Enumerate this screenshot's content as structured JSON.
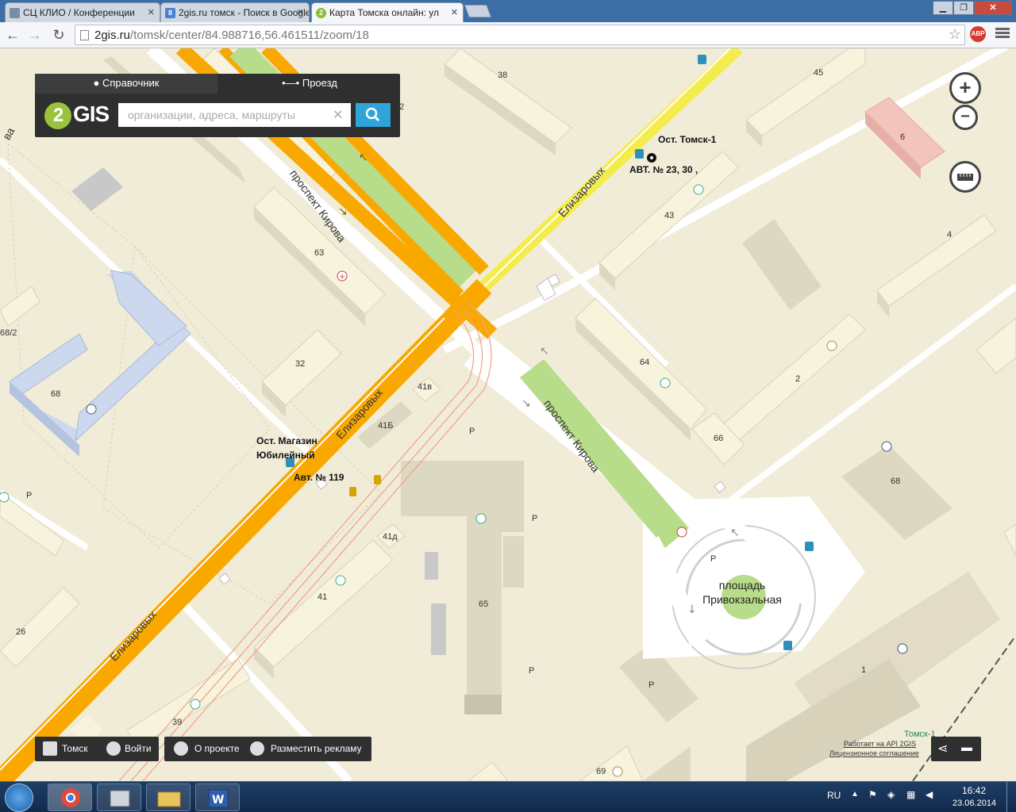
{
  "browser": {
    "tabs": [
      {
        "title": "СЦ КЛИО / Конференции",
        "close": "✕"
      },
      {
        "title": "2gis.ru томск - Поиск в Google",
        "close": "✕"
      },
      {
        "title": "Карта Томска онлайн: ул",
        "close": "✕"
      }
    ],
    "url_host": "2gis.ru",
    "url_path": "/tomsk/center/84.988716,56.461511/zoom/18",
    "abp_label": "ABP"
  },
  "panel": {
    "tab_directory": "Справочник",
    "tab_route": "Проезд",
    "logo_text": "GIS",
    "logo_digit": "2",
    "search_placeholder": "организации, адреса, маршруты",
    "clear": "✕"
  },
  "map": {
    "streets": {
      "kirova_top": "проспект Кирова",
      "kirova_bottom": "проспект Кирова",
      "elizarovykh_top": "Елизаровых",
      "elizarovykh_mid": "Елизаровых",
      "elizarovykh_bottom": "Елизаровых",
      "left_partial": "ва"
    },
    "buildings": [
      "38",
      "45",
      "6",
      "43",
      "4",
      "63",
      "64",
      "2",
      "32",
      "68/2",
      "68",
      "41в",
      "41Б",
      "66",
      "68",
      "41д",
      "41",
      "65",
      "26",
      "39",
      "1",
      "69",
      "2"
    ],
    "stops": {
      "tomsk1_name": "Ост. Томск-1",
      "tomsk1_routes": "АВТ. № 23, 30 ,",
      "magazin_name_1": "Ост. Магазин",
      "magazin_name_2": "Юбилейный",
      "magazin_routes": "Авт. № 119"
    },
    "square_1": "площадь",
    "square_2": "Привокзальная",
    "tomsk1_station": "Томск-1",
    "parking": "P"
  },
  "zoom": {
    "in": "+",
    "out": "−"
  },
  "bottom": {
    "city": "Томск",
    "login": "Войти",
    "about": "О проекте",
    "advertise": "Разместить рекламу",
    "credit_1": "Работает на API 2GIS",
    "credit_2": "Лицензионное соглашение"
  },
  "taskbar": {
    "lang": "RU",
    "time": "16:42",
    "date": "23.06.2014"
  },
  "colors": {
    "main_road": "#f9a800",
    "yellow_road": "#f4ec4c",
    "median": "#b7dc8a",
    "block": "#f1ecd8",
    "building": "#f7f3dc",
    "building_side": "#ddd8c2",
    "school": "#ccd8ee",
    "pink": "#f3c4bc",
    "search_btn": "#2ea4d9"
  }
}
